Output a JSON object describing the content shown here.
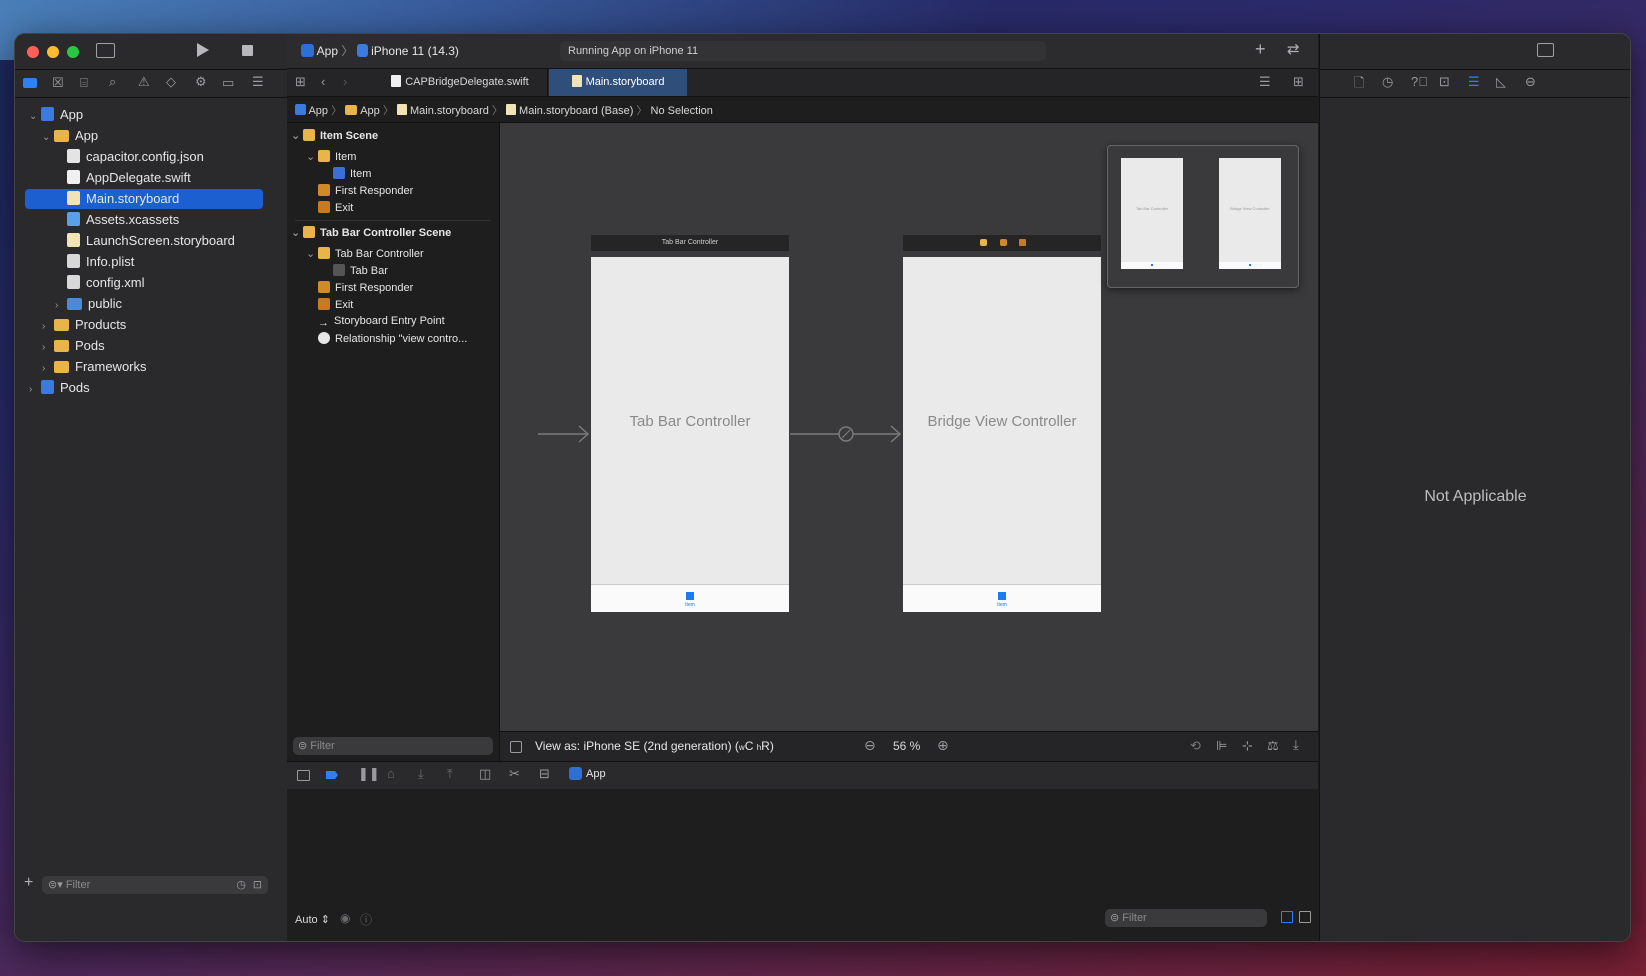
{
  "toolbar": {
    "scheme": "App",
    "destination": "iPhone 11 (14.3)",
    "status": "Running App on iPhone 11"
  },
  "tabs": [
    {
      "label": "CAPBridgeDelegate.swift",
      "active": false
    },
    {
      "label": "Main.storyboard",
      "active": true
    }
  ],
  "breadcrumb": [
    "App",
    "App",
    "Main.storyboard",
    "Main.storyboard (Base)",
    "No Selection"
  ],
  "navigator": {
    "items": [
      {
        "label": "App",
        "depth": 0,
        "type": "proj",
        "expanded": true
      },
      {
        "label": "App",
        "depth": 1,
        "type": "folder",
        "expanded": true
      },
      {
        "label": "capacitor.config.json",
        "depth": 2,
        "type": "json"
      },
      {
        "label": "AppDelegate.swift",
        "depth": 2,
        "type": "swift"
      },
      {
        "label": "Main.storyboard",
        "depth": 2,
        "type": "sb",
        "selected": true
      },
      {
        "label": "Assets.xcassets",
        "depth": 2,
        "type": "xc"
      },
      {
        "label": "LaunchScreen.storyboard",
        "depth": 2,
        "type": "sb"
      },
      {
        "label": "Info.plist",
        "depth": 2,
        "type": "plist"
      },
      {
        "label": "config.xml",
        "depth": 2,
        "type": "xml"
      },
      {
        "label": "public",
        "depth": 2,
        "type": "folderblue",
        "collapsed": true
      },
      {
        "label": "Products",
        "depth": 1,
        "type": "folder",
        "collapsed": true
      },
      {
        "label": "Pods",
        "depth": 1,
        "type": "folder",
        "collapsed": true
      },
      {
        "label": "Frameworks",
        "depth": 1,
        "type": "folder",
        "collapsed": true
      },
      {
        "label": "Pods",
        "depth": 0,
        "type": "proj",
        "collapsed": true
      }
    ],
    "filter_placeholder": "Filter"
  },
  "outline": {
    "rows": [
      {
        "label": "Item Scene",
        "depth": 0,
        "bold": true,
        "chev": true
      },
      {
        "label": "Item",
        "depth": 1,
        "chev": true
      },
      {
        "label": "Item",
        "depth": 2
      },
      {
        "label": "First Responder",
        "depth": 1
      },
      {
        "label": "Exit",
        "depth": 1
      },
      {
        "label": "Tab Bar Controller Scene",
        "depth": 0,
        "bold": true,
        "chev": true
      },
      {
        "label": "Tab Bar Controller",
        "depth": 1,
        "chev": true
      },
      {
        "label": "Tab Bar",
        "depth": 2
      },
      {
        "label": "First Responder",
        "depth": 1
      },
      {
        "label": "Exit",
        "depth": 1
      },
      {
        "label": "Storyboard Entry Point",
        "depth": 1
      },
      {
        "label": "Relationship \"view contro...",
        "depth": 1
      }
    ],
    "filter_placeholder": "Filter"
  },
  "canvas": {
    "scene1_title": "Tab Bar Controller",
    "scene1_label": "Tab Bar Controller",
    "scene1_tab": "Item",
    "scene2_label": "Bridge View Controller",
    "scene2_tab": "Item",
    "mini1": "Tab Bar Controller",
    "mini2": "Bridge View Controller"
  },
  "canvas_bar": {
    "view_as": "View as: iPhone SE (2nd generation) (",
    "size_class_w": "w",
    "size_class_c": "C",
    "size_class_h": "h",
    "size_class_r": "R)",
    "zoom": "56 %"
  },
  "debug": {
    "target": "App"
  },
  "console": {
    "mode": "Auto",
    "filter_placeholder": "Filter"
  },
  "inspector": {
    "empty_text": "Not Applicable"
  }
}
